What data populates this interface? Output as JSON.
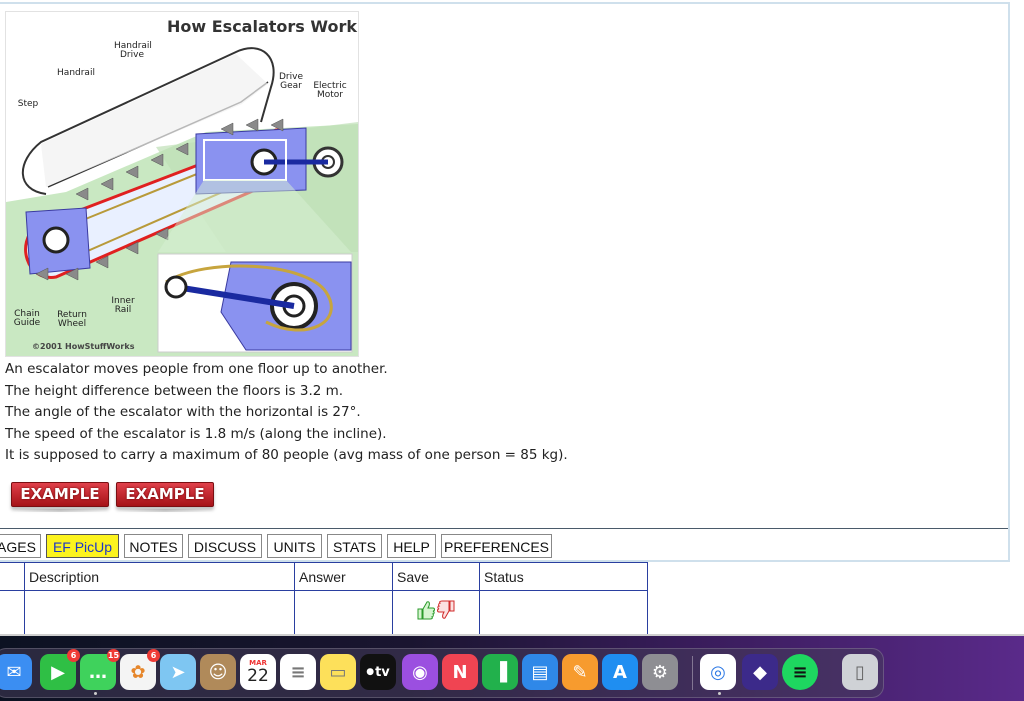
{
  "diagram": {
    "title": "How Escalators Work",
    "labels": {
      "handrail_drive": "Handrail Drive",
      "handrail": "Handrail",
      "step": "Step",
      "drive_gear": "Drive Gear",
      "electric_motor": "Electric Motor",
      "inner_rail": "Inner Rail",
      "chain_guide": "Chain Guide",
      "return_wheel": "Return Wheel"
    },
    "copyright": "©2001 HowStuffWorks"
  },
  "problem": {
    "lines": [
      "An escalator moves people from one floor up to another.",
      "The height difference between the floors is 3.2 m.",
      "The angle of the escalator with the horizontal is 27°.",
      "The speed of the escalator is 1.8 m/s (along the incline).",
      "It is supposed to carry a maximum of 80 people (avg mass of one person = 85 kg)."
    ],
    "example_buttons": [
      "EXAMPLE",
      "EXAMPLE"
    ]
  },
  "tabs": [
    {
      "label": "AGES"
    },
    {
      "label": "EF PicUp",
      "active": true
    },
    {
      "label": "NOTES"
    },
    {
      "label": "DISCUSS"
    },
    {
      "label": "UNITS"
    },
    {
      "label": "STATS"
    },
    {
      "label": "HELP"
    },
    {
      "label": "PREFERENCES"
    }
  ],
  "table": {
    "headers": [
      "Description",
      "Answer",
      "Save",
      "Status"
    ]
  },
  "dock": {
    "items": [
      {
        "name": "Mail",
        "color": "#3b8ef2",
        "icon": "mail-icon"
      },
      {
        "name": "FaceTime",
        "color": "#2fbf45",
        "badge": "6",
        "icon": "facetime-icon"
      },
      {
        "name": "Messages",
        "color": "#3fd25c",
        "badge": "15",
        "icon": "messages-icon"
      },
      {
        "name": "Photos",
        "color": "#f4f4f4",
        "badge": "6",
        "icon": "photos-icon"
      },
      {
        "name": "Maps",
        "color": "#7ec6f2",
        "icon": "maps-icon"
      },
      {
        "name": "Contacts",
        "color": "#b08a5a",
        "icon": "contacts-icon"
      },
      {
        "name": "Calendar",
        "color": "#ffffff",
        "month": "MAR",
        "day": "22",
        "icon": "calendar-icon"
      },
      {
        "name": "Reminders",
        "color": "#ffffff",
        "icon": "reminders-icon"
      },
      {
        "name": "Notes",
        "color": "#fde05a",
        "icon": "notes-icon"
      },
      {
        "name": "TV",
        "color": "#111111",
        "label": "tv",
        "icon": "tv-icon"
      },
      {
        "name": "Podcasts",
        "color": "#9b4fe0",
        "icon": "podcasts-icon"
      },
      {
        "name": "News",
        "color": "#f04452",
        "icon": "news-icon"
      },
      {
        "name": "Numbers",
        "color": "#22b14c",
        "icon": "numbers-icon"
      },
      {
        "name": "Keynote",
        "color": "#2f88e8",
        "icon": "keynote-icon"
      },
      {
        "name": "Pages",
        "color": "#f79b2e",
        "icon": "pages-icon"
      },
      {
        "name": "App Store",
        "color": "#1f8ef1",
        "icon": "app-store-icon"
      },
      {
        "name": "System Preferences",
        "color": "#8e8e93",
        "icon": "settings-icon"
      },
      {
        "name": "Chrome",
        "color": "#ffffff",
        "icon": "chrome-icon"
      },
      {
        "name": "Shortcut",
        "color": "#3c2a8a",
        "icon": "diamond-icon"
      },
      {
        "name": "Spotify",
        "color": "#1ed760",
        "icon": "spotify-icon"
      },
      {
        "name": "Trash",
        "color": "#cfd2d6",
        "icon": "trash-icon"
      }
    ]
  }
}
